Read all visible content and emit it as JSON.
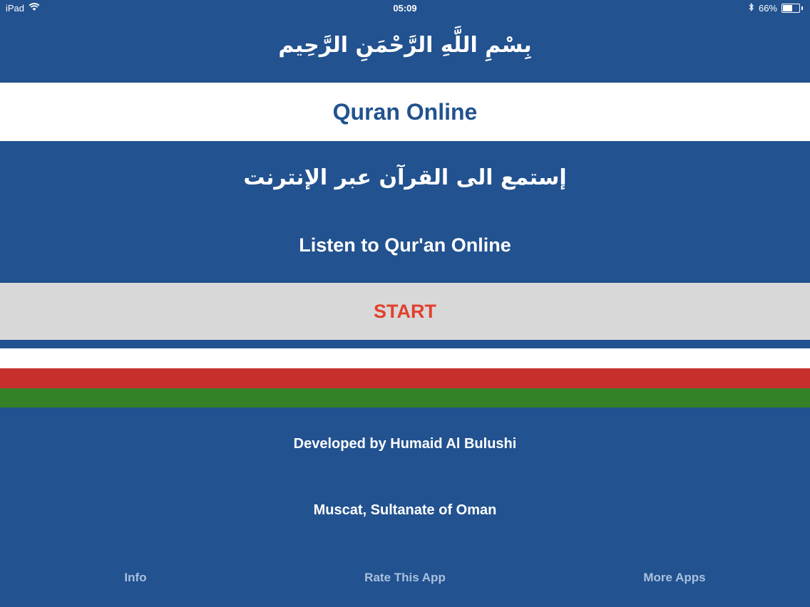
{
  "status_bar": {
    "device": "iPad",
    "time": "05:09",
    "battery": "66%",
    "battery_level": 0.66
  },
  "header": {
    "basmala": "بِسْمِ اللَّهِ الرَّحْمَنِ الرَّحِيم",
    "title": "Quran Online"
  },
  "main": {
    "arabic_subtitle": "إستمع الى القرآن عبر الإنترنت",
    "english_subtitle": "Listen to Qur'an Online",
    "start_label": "START"
  },
  "colors": {
    "background": "#22528f",
    "start_text": "#e2402d",
    "stripe_white": "#ffffff",
    "stripe_red": "#c62f2b",
    "stripe_green": "#348127"
  },
  "credits": {
    "developer": "Developed by Humaid Al Bulushi",
    "location": "Muscat, Sultanate of Oman"
  },
  "tabbar": {
    "info": "Info",
    "rate": "Rate This App",
    "more": "More Apps"
  },
  "icons": [
    "wifi-icon",
    "bluetooth-icon",
    "battery-icon"
  ]
}
